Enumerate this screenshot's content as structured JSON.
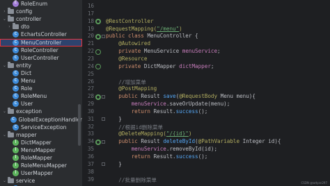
{
  "tree": [
    {
      "label": "RoleEnum",
      "icon": "enum-icon",
      "kind": "enum",
      "indent": 2
    },
    {
      "label": "config",
      "icon": "folder-icon",
      "kind": "folder",
      "indent": 1,
      "chevron": "›"
    },
    {
      "label": "controller",
      "icon": "folder-icon",
      "kind": "folder",
      "indent": 1,
      "chevron": "⌄"
    },
    {
      "label": "dto",
      "icon": "folder-icon",
      "kind": "folder",
      "indent": 2,
      "chevron": "›"
    },
    {
      "label": "EchartsController",
      "icon": "class-icon",
      "kind": "class",
      "indent": 2
    },
    {
      "label": "MenuController",
      "icon": "class-icon",
      "kind": "class",
      "indent": 2,
      "selected": true
    },
    {
      "label": "RoleController",
      "icon": "class-icon",
      "kind": "class",
      "indent": 2
    },
    {
      "label": "UserController",
      "icon": "class-icon",
      "kind": "class",
      "indent": 2
    },
    {
      "label": "entity",
      "icon": "folder-icon",
      "kind": "folder",
      "indent": 1,
      "chevron": "⌄"
    },
    {
      "label": "Dict",
      "icon": "class-icon",
      "kind": "class",
      "indent": 2
    },
    {
      "label": "Menu",
      "icon": "class-icon",
      "kind": "class",
      "indent": 2
    },
    {
      "label": "Role",
      "icon": "class-icon",
      "kind": "class",
      "indent": 2
    },
    {
      "label": "RoleMenu",
      "icon": "class-icon",
      "kind": "class",
      "indent": 2
    },
    {
      "label": "User",
      "icon": "class-icon",
      "kind": "class",
      "indent": 2
    },
    {
      "label": "exception",
      "icon": "folder-icon",
      "kind": "folder",
      "indent": 1,
      "chevron": "⌄"
    },
    {
      "label": "GlobalExceptionHandler",
      "icon": "class-icon",
      "kind": "class",
      "indent": 2
    },
    {
      "label": "ServiceException",
      "icon": "class-icon",
      "kind": "class",
      "indent": 2
    },
    {
      "label": "mapper",
      "icon": "folder-icon",
      "kind": "folder",
      "indent": 1,
      "chevron": "⌄"
    },
    {
      "label": "DictMapper",
      "icon": "interface-icon",
      "kind": "iface",
      "indent": 2
    },
    {
      "label": "MenuMapper",
      "icon": "interface-icon",
      "kind": "iface",
      "indent": 2
    },
    {
      "label": "RoleMapper",
      "icon": "interface-icon",
      "kind": "iface",
      "indent": 2
    },
    {
      "label": "RoleMenuMapper",
      "icon": "interface-icon",
      "kind": "iface",
      "indent": 2
    },
    {
      "label": "UserMapper",
      "icon": "interface-icon",
      "kind": "iface",
      "indent": 2
    },
    {
      "label": "service",
      "icon": "folder-icon",
      "kind": "folder",
      "indent": 1,
      "chevron": "⌄"
    },
    {
      "label": "MenuService",
      "icon": "class-icon",
      "kind": "class",
      "indent": 2
    }
  ],
  "gutter": {
    "line_numbers": [
      "16",
      "17",
      "18",
      "19",
      "20",
      "21",
      "22",
      "23",
      "24",
      "25",
      "26",
      "27",
      "28",
      "29",
      "30",
      "31",
      "32",
      "33",
      "34",
      "35",
      "36",
      "37",
      "38",
      "39"
    ]
  },
  "code": [
    [],
    [],
    [
      {
        "t": "@RestController",
        "c": "ann"
      }
    ],
    [
      {
        "t": "@RequestMapping(",
        "c": "ann"
      },
      {
        "t": "\"/menu\"",
        "c": "str"
      },
      {
        "t": ")",
        "c": "ann"
      }
    ],
    [
      {
        "t": "public class ",
        "c": "kw"
      },
      {
        "t": "MenuController {"
      }
    ],
    [
      {
        "t": "    "
      },
      {
        "t": "@Autowired",
        "c": "ann"
      }
    ],
    [
      {
        "t": "    "
      },
      {
        "t": "private ",
        "c": "kw"
      },
      {
        "t": "MenuService "
      },
      {
        "t": "menuService",
        "c": "fld"
      },
      {
        "t": ";"
      }
    ],
    [
      {
        "t": "    "
      },
      {
        "t": "@Resource",
        "c": "ann"
      }
    ],
    [
      {
        "t": "    "
      },
      {
        "t": "private ",
        "c": "kw"
      },
      {
        "t": "DictMapper "
      },
      {
        "t": "dictMapper",
        "c": "fld"
      },
      {
        "t": ";"
      }
    ],
    [],
    [
      {
        "t": "    "
      },
      {
        "t": "//增加菜单",
        "c": "cm"
      }
    ],
    [
      {
        "t": "    "
      },
      {
        "t": "@PostMapping",
        "c": "ann"
      }
    ],
    [
      {
        "t": "    "
      },
      {
        "t": "public ",
        "c": "kw"
      },
      {
        "t": "Result "
      },
      {
        "t": "save",
        "c": "fn"
      },
      {
        "t": "("
      },
      {
        "t": "@RequestBody",
        "c": "ann"
      },
      {
        "t": " Menu menu){"
      }
    ],
    [
      {
        "t": "        "
      },
      {
        "t": "menuService",
        "c": "fld"
      },
      {
        "t": ".saveOrUpdate(menu);"
      }
    ],
    [
      {
        "t": "        "
      },
      {
        "t": "return ",
        "c": "kw"
      },
      {
        "t": "Result."
      },
      {
        "t": "success",
        "c": "fn"
      },
      {
        "t": "();"
      }
    ],
    [
      {
        "t": "    }"
      }
    ],
    [
      {
        "t": "    "
      },
      {
        "t": "//根据id删除菜单",
        "c": "cm"
      }
    ],
    [
      {
        "t": "    "
      },
      {
        "t": "@DeleteMapping(",
        "c": "ann"
      },
      {
        "t": "\"/{id}\"",
        "c": "str"
      },
      {
        "t": ")",
        "c": "ann"
      }
    ],
    [
      {
        "t": "    "
      },
      {
        "t": "public ",
        "c": "kw"
      },
      {
        "t": "Result "
      },
      {
        "t": "deleteById",
        "c": "fn"
      },
      {
        "t": "("
      },
      {
        "t": "@PathVariable",
        "c": "ann"
      },
      {
        "t": " Integer id){"
      }
    ],
    [
      {
        "t": "        "
      },
      {
        "t": "menuService",
        "c": "fld"
      },
      {
        "t": ".removeById(id);"
      }
    ],
    [
      {
        "t": "        "
      },
      {
        "t": "return ",
        "c": "kw"
      },
      {
        "t": "Result."
      },
      {
        "t": "success",
        "c": "fn"
      },
      {
        "t": "();"
      }
    ],
    [
      {
        "t": "    }"
      }
    ],
    [],
    [
      {
        "t": "    "
      },
      {
        "t": "//批量删除菜单",
        "c": "cm"
      }
    ]
  ],
  "watermark": "CSDN @wdyan297"
}
